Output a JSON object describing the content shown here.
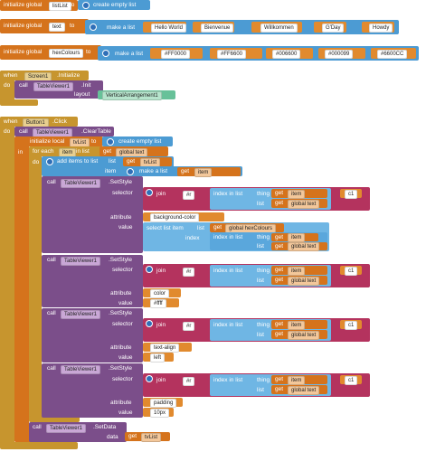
{
  "init1": {
    "keyword": "initialize global",
    "var": "listList",
    "to": "to",
    "make": "create empty list"
  },
  "init2": {
    "keyword": "initialize global",
    "var": "text",
    "to": "to",
    "make": "make a list",
    "items": [
      "Hello World",
      "Bienvenue",
      "Willkommen",
      "G'Day",
      "Howdy"
    ]
  },
  "init3": {
    "keyword": "initialize global",
    "var": "hexColours",
    "to": "to",
    "make": "make a list",
    "items": [
      "#FF0000",
      "#FF6600",
      "#006600",
      "#000099",
      "#6600CC"
    ]
  },
  "screen_init": {
    "when": "when",
    "component": "Screen1",
    "event": ".Initialize",
    "do": "do",
    "call": "call",
    "viewer": "TableViewer1",
    "method": ".Init",
    "layout_label": "layout",
    "layout_value": "VerticalArrangement1"
  },
  "button_click": {
    "when": "when",
    "component": "Button1",
    "event": ".Click",
    "do": "do",
    "call": "call",
    "viewer": "TableViewer1",
    "clear": ".ClearTable",
    "init_local": "initialize local",
    "local_var": "tvList",
    "to": "to",
    "create_empty": "create empty list",
    "in": "in",
    "for_each": "for each",
    "item": "item",
    "in_list": "in list",
    "get": "get",
    "global_text": "global text",
    "do2": "do",
    "add_items": "add items to list",
    "list": "list",
    "get_tvlist": "tvList",
    "item_label": "item",
    "make_a_list": "make a list",
    "get_item": "item",
    "setstyle": ".SetStyle",
    "selector": "selector",
    "join": "join",
    "hash": "#r",
    "index_in_list": "index in list",
    "thing": "thing",
    "c1": "c1",
    "attribute": "attribute",
    "value": "value",
    "styles": [
      {
        "attribute": "background-color",
        "value_kind": "select",
        "value": ""
      },
      {
        "attribute": "color",
        "value_kind": "text",
        "value": "#ffff"
      },
      {
        "attribute": "text-align",
        "value_kind": "text",
        "value": "left"
      },
      {
        "attribute": "padding",
        "value_kind": "text",
        "value": "10px"
      }
    ],
    "select_list_item": "select list item",
    "list_label": "list",
    "global_hex": "global hexColours",
    "index": "index",
    "setdata": ".SetData",
    "data": "data"
  }
}
